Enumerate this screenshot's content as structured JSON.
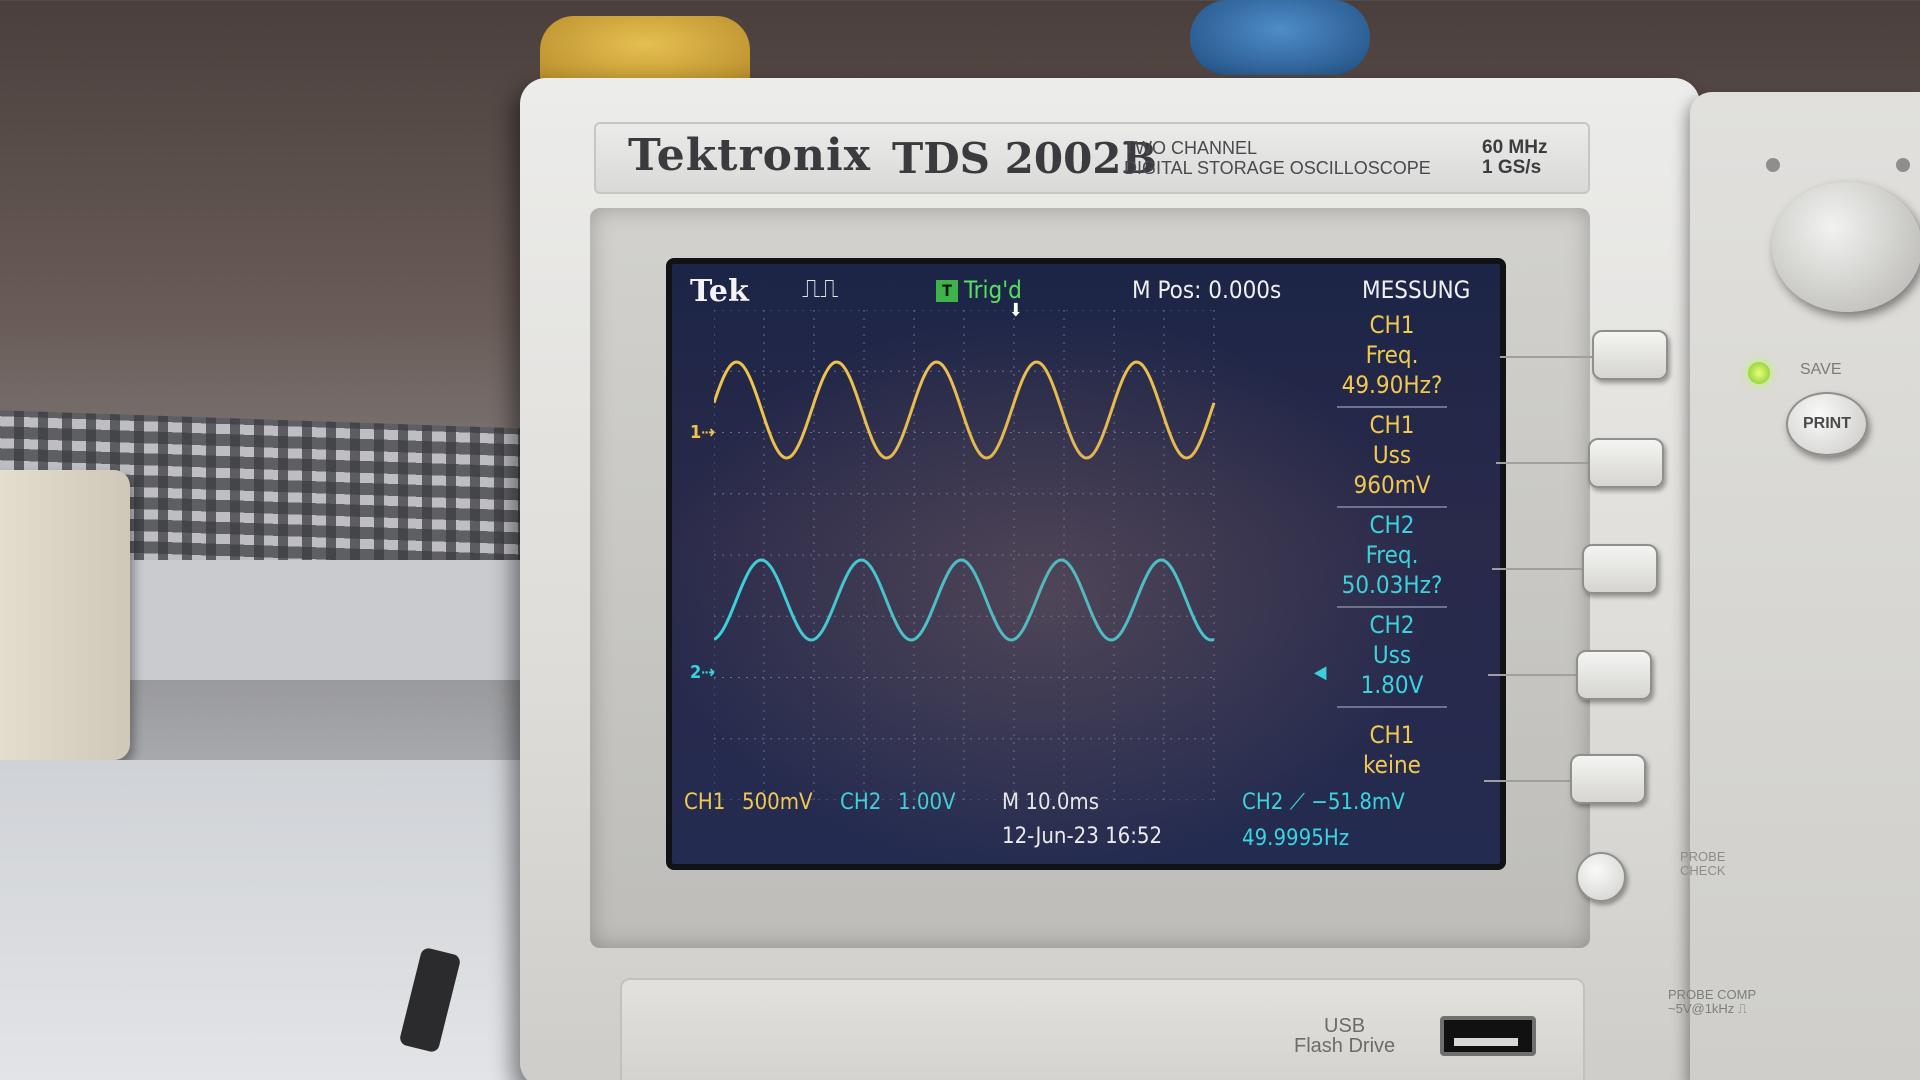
{
  "instrument": {
    "brand": "Tektronix",
    "model": "TDS 2002B",
    "description_line1": "TWO CHANNEL",
    "description_line2": "DIGITAL STORAGE OSCILLOSCOPE",
    "bandwidth": "60 MHz",
    "sample_rate": "1 GS/s"
  },
  "screen": {
    "logo": "Tek",
    "acquire_icon": "⎍⎍",
    "trigger_indicator": "T",
    "trigger_status": "Trig'd",
    "horizontal_position": "M Pos: 0.000s",
    "menu_title": "MESSUNG",
    "ch1_marker": "1⇢",
    "ch2_marker": "2⇢",
    "trigger_marker": "⬇",
    "ch2_trigger_level_marker": "◀",
    "measurements": [
      {
        "source": "CH1",
        "type": "Freq.",
        "value": "49.90Hz?",
        "color": "#f2c84e"
      },
      {
        "source": "CH1",
        "type": "Uss",
        "value": "960mV",
        "color": "#f2c84e"
      },
      {
        "source": "CH2",
        "type": "Freq.",
        "value": "50.03Hz?",
        "color": "#3ad4e0"
      },
      {
        "source": "CH2",
        "type": "Uss",
        "value": "1.80V",
        "color": "#3ad4e0"
      },
      {
        "source": "CH1",
        "type": "keine",
        "value": "",
        "color": "#f2c84e"
      }
    ],
    "ch1_label": "CH1",
    "ch1_scale": "500mV",
    "ch2_label": "CH2",
    "ch2_scale": "1.00V",
    "timebase": "M 10.0ms",
    "trigger_info": "CH2 ⟋ −51.8mV",
    "date_time": "12-Jun-23 16:52",
    "trigger_frequency": "49.9995Hz"
  },
  "waveforms": {
    "ch1": {
      "color": "#f0c34b",
      "cycles": 5,
      "level": 0.5
    },
    "ch2": {
      "color": "#35d6e3",
      "cycles": 5,
      "level": 0.5
    }
  },
  "panel": {
    "save_label": "SAVE",
    "print_label": "PRINT",
    "probe_check_label": "PROBE\nCHECK",
    "probe_comp_label": "PROBE COMP\n~5V@1kHz ⎍",
    "usb_label_line1": "USB",
    "usb_label_line2": "Flash Drive"
  }
}
